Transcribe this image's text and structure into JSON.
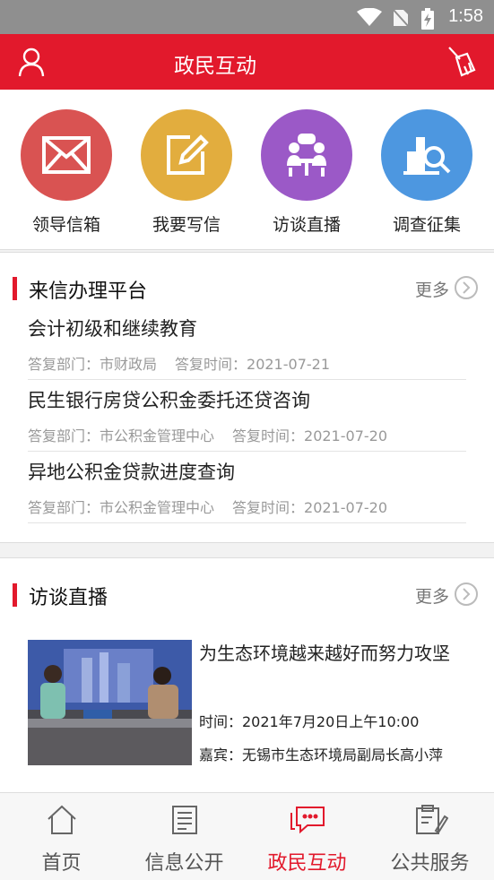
{
  "status_bar": {
    "time": "1:58"
  },
  "app_bar": {
    "title": "政民互动"
  },
  "quick_actions": [
    {
      "label": "领导信箱",
      "color": "#d95352",
      "icon": "mail-icon"
    },
    {
      "label": "我要写信",
      "color": "#e2ad3e",
      "icon": "edit-icon"
    },
    {
      "label": "访谈直播",
      "color": "#9b59c7",
      "icon": "interview-icon"
    },
    {
      "label": "调查征集",
      "color": "#4d97e0",
      "icon": "survey-icon"
    }
  ],
  "letters_section": {
    "title": "来信办理平台",
    "more": "更多",
    "items": [
      {
        "title": "会计初级和继续教育",
        "dept": "答复部门：市财政局",
        "time": "答复时间：2021-07-21"
      },
      {
        "title": "民生银行房贷公积金委托还贷咨询",
        "dept": "答复部门：市公积金管理中心",
        "time": "答复时间：2021-07-20"
      },
      {
        "title": "异地公积金贷款进度查询",
        "dept": "答复部门：市公积金管理中心",
        "time": "答复时间：2021-07-20"
      }
    ]
  },
  "interview_section": {
    "title": "访谈直播",
    "more": "更多",
    "item": {
      "title": "为生态环境越来越好而努力攻坚",
      "time": "时间：2021年7月20日上午10:00",
      "guest": "嘉宾：无锡市生态环境局副局长高小萍"
    }
  },
  "tab_bar": [
    {
      "label": "首页",
      "icon": "home-icon",
      "active": false
    },
    {
      "label": "信息公开",
      "icon": "document-icon",
      "active": false
    },
    {
      "label": "政民互动",
      "icon": "chat-icon",
      "active": true
    },
    {
      "label": "公共服务",
      "icon": "service-icon",
      "active": false
    }
  ],
  "colors": {
    "brand": "#e2192c",
    "status_bar": "#8f8f8f"
  }
}
